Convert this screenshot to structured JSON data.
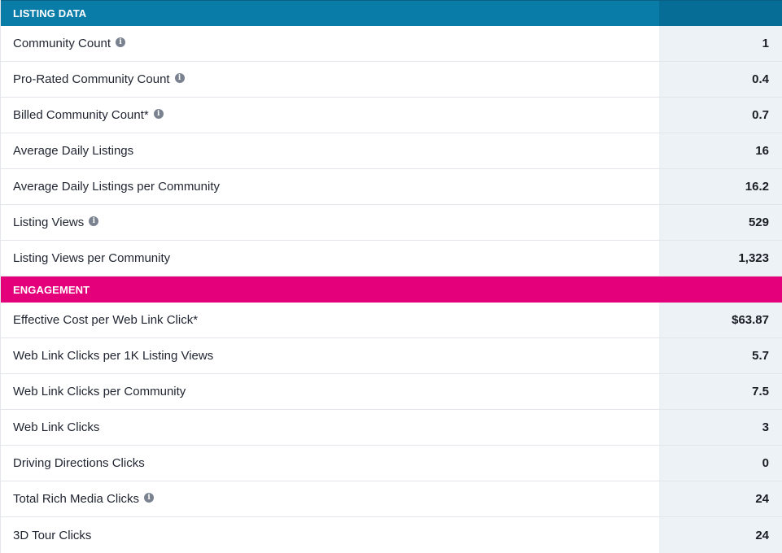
{
  "sections": [
    {
      "title": "LISTING DATA",
      "rows": [
        {
          "label": "Community Count",
          "info": true,
          "value": "1"
        },
        {
          "label": "Pro-Rated Community Count",
          "info": true,
          "value": "0.4"
        },
        {
          "label": "Billed Community Count*",
          "info": true,
          "value": "0.7"
        },
        {
          "label": "Average Daily Listings",
          "info": false,
          "value": "16"
        },
        {
          "label": "Average Daily Listings per Community",
          "info": false,
          "value": "16.2"
        },
        {
          "label": "Listing Views",
          "info": true,
          "value": "529"
        },
        {
          "label": "Listing Views per Community",
          "info": false,
          "value": "1,323"
        }
      ]
    },
    {
      "title": "ENGAGEMENT",
      "rows": [
        {
          "label": "Effective Cost per Web Link Click*",
          "info": false,
          "value": "$63.87"
        },
        {
          "label": "Web Link Clicks per 1K Listing Views",
          "info": false,
          "value": "5.7"
        },
        {
          "label": "Web Link Clicks per Community",
          "info": false,
          "value": "7.5"
        },
        {
          "label": "Web Link Clicks",
          "info": false,
          "value": "3"
        },
        {
          "label": "Driving Directions Clicks",
          "info": false,
          "value": "0"
        },
        {
          "label": "Total Rich Media Clicks",
          "info": true,
          "value": "24"
        },
        {
          "label": "3D Tour Clicks",
          "info": false,
          "value": "24"
        }
      ]
    }
  ],
  "colors": {
    "listing_header": "#0a7ca8",
    "engagement_header": "#e4007a",
    "value_column_bg": "#edf2f7"
  },
  "icons": {
    "info": "info-icon"
  }
}
